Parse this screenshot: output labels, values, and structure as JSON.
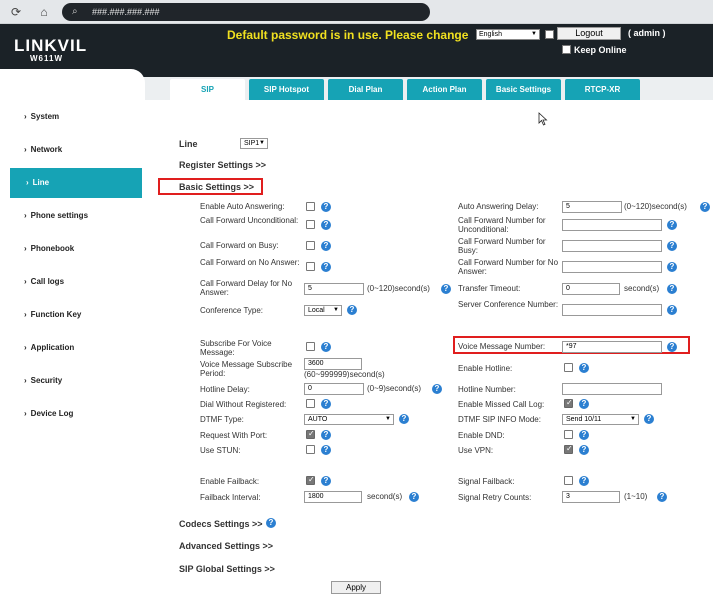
{
  "browser": {
    "url": "###.###.###.###"
  },
  "header": {
    "logo": "LINKVIL",
    "model": "W611W",
    "warning": "Default password is in use. Please change",
    "language": "English",
    "logout": "Logout",
    "user": "( admin )",
    "keep_online": "Keep Online"
  },
  "sidebar": {
    "items": [
      "System",
      "Network",
      "Line",
      "Phone settings",
      "Phonebook",
      "Call logs",
      "Function Key",
      "Application",
      "Security",
      "Device Log"
    ]
  },
  "tabs": [
    "SIP",
    "SIP Hotspot",
    "Dial Plan",
    "Action Plan",
    "Basic Settings",
    "RTCP-XR"
  ],
  "form": {
    "line_label": "Line",
    "line_value": "SIP1",
    "register_settings": "Register Settings >>",
    "basic_settings": "Basic Settings >>",
    "codecs_settings": "Codecs Settings >>",
    "advanced_settings": "Advanced Settings >>",
    "sip_global_settings": "SIP Global Settings >>",
    "apply": "Apply",
    "left": {
      "enable_auto_answering": "Enable Auto Answering:",
      "cf_unconditional": "Call Forward Unconditional:",
      "cf_busy": "Call Forward on Busy:",
      "cf_no_answer": "Call Forward on No Answer:",
      "cf_delay": "Call Forward Delay for No Answer:",
      "cf_delay_value": "5",
      "cf_delay_unit": "(0~120)second(s)",
      "conference_type": "Conference Type:",
      "conference_value": "Local",
      "subscribe_vm": "Subscribe For Voice Message:",
      "vm_period": "Voice Message Subscribe Period:",
      "vm_period_value": "3600",
      "vm_period_unit": "(60~999999)second(s)",
      "hotline_delay": "Hotline Delay:",
      "hotline_delay_value": "0",
      "hotline_delay_unit": "(0~9)second(s)",
      "dial_without_reg": "Dial Without Registered:",
      "dtmf_type": "DTMF Type:",
      "dtmf_type_value": "AUTO",
      "request_with_port": "Request With Port:",
      "use_stun": "Use STUN:",
      "enable_failback": "Enable Failback:",
      "failback_interval": "Failback Interval:",
      "failback_interval_value": "1800",
      "failback_interval_unit": "second(s)"
    },
    "right": {
      "auto_answer_delay": "Auto Answering Delay:",
      "auto_answer_delay_value": "5",
      "auto_answer_delay_unit": "(0~120)second(s)",
      "cf_num_unconditional": "Call Forward Number for Unconditional:",
      "cf_num_busy": "Call Forward Number for Busy:",
      "cf_num_no_answer": "Call Forward Number for No Answer:",
      "transfer_timeout": "Transfer Timeout:",
      "transfer_timeout_value": "0",
      "transfer_timeout_unit": "second(s)",
      "server_conf_number": "Server Conference Number:",
      "vm_number": "Voice Message Number:",
      "vm_number_value": "*97",
      "enable_hotline": "Enable Hotline:",
      "hotline_number": "Hotline Number:",
      "enable_missed_call": "Enable Missed Call Log:",
      "dtmf_sip_info_mode": "DTMF SIP INFO Mode:",
      "dtmf_sip_info_value": "Send 10/11",
      "enable_dnd": "Enable DND:",
      "use_vpn": "Use VPN:",
      "signal_failback": "Signal Failback:",
      "signal_retry": "Signal Retry Counts:",
      "signal_retry_value": "3",
      "signal_retry_unit": "(1~10)"
    }
  }
}
